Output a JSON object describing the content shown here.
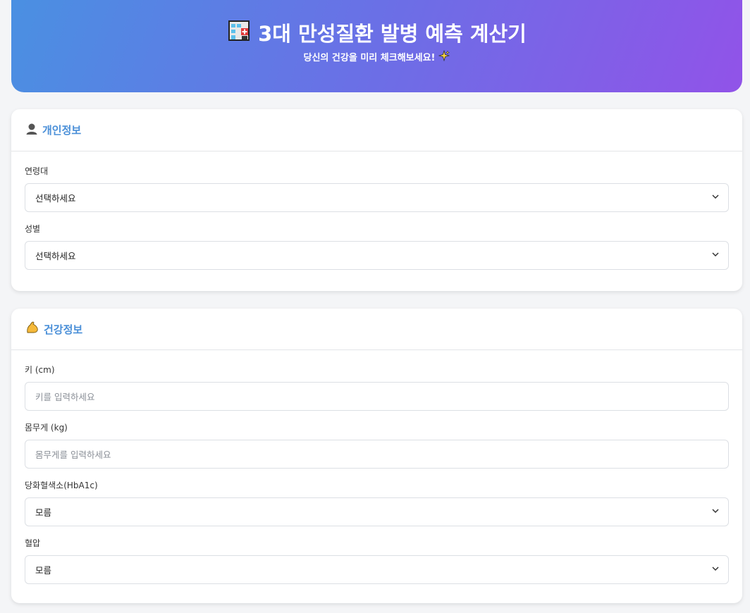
{
  "header": {
    "title": "3대 만성질환 발병 예측 계산기",
    "title_icon": "hospital-icon",
    "subtitle": "당신의 건강을 미리 체크해보세요!",
    "subtitle_icon": "sparkles-icon"
  },
  "personal": {
    "title": "개인정보",
    "icon": "person-silhouette-icon",
    "age_label": "연령대",
    "age_value": "선택하세요",
    "gender_label": "성별",
    "gender_value": "선택하세요"
  },
  "health": {
    "title": "건강정보",
    "icon": "flexed-biceps-icon",
    "height_label": "키 (cm)",
    "height_placeholder": "키를 입력하세요",
    "weight_label": "몸무게 (kg)",
    "weight_placeholder": "몸무게를 입력하세요",
    "hba1c_label": "당화혈색소(HbA1c)",
    "hba1c_value": "모름",
    "bp_label": "혈압",
    "bp_value": "모름"
  },
  "colors": {
    "accent": "#4a8fd8",
    "gradient_start": "#4a90e2",
    "gradient_end": "#9153e8"
  }
}
